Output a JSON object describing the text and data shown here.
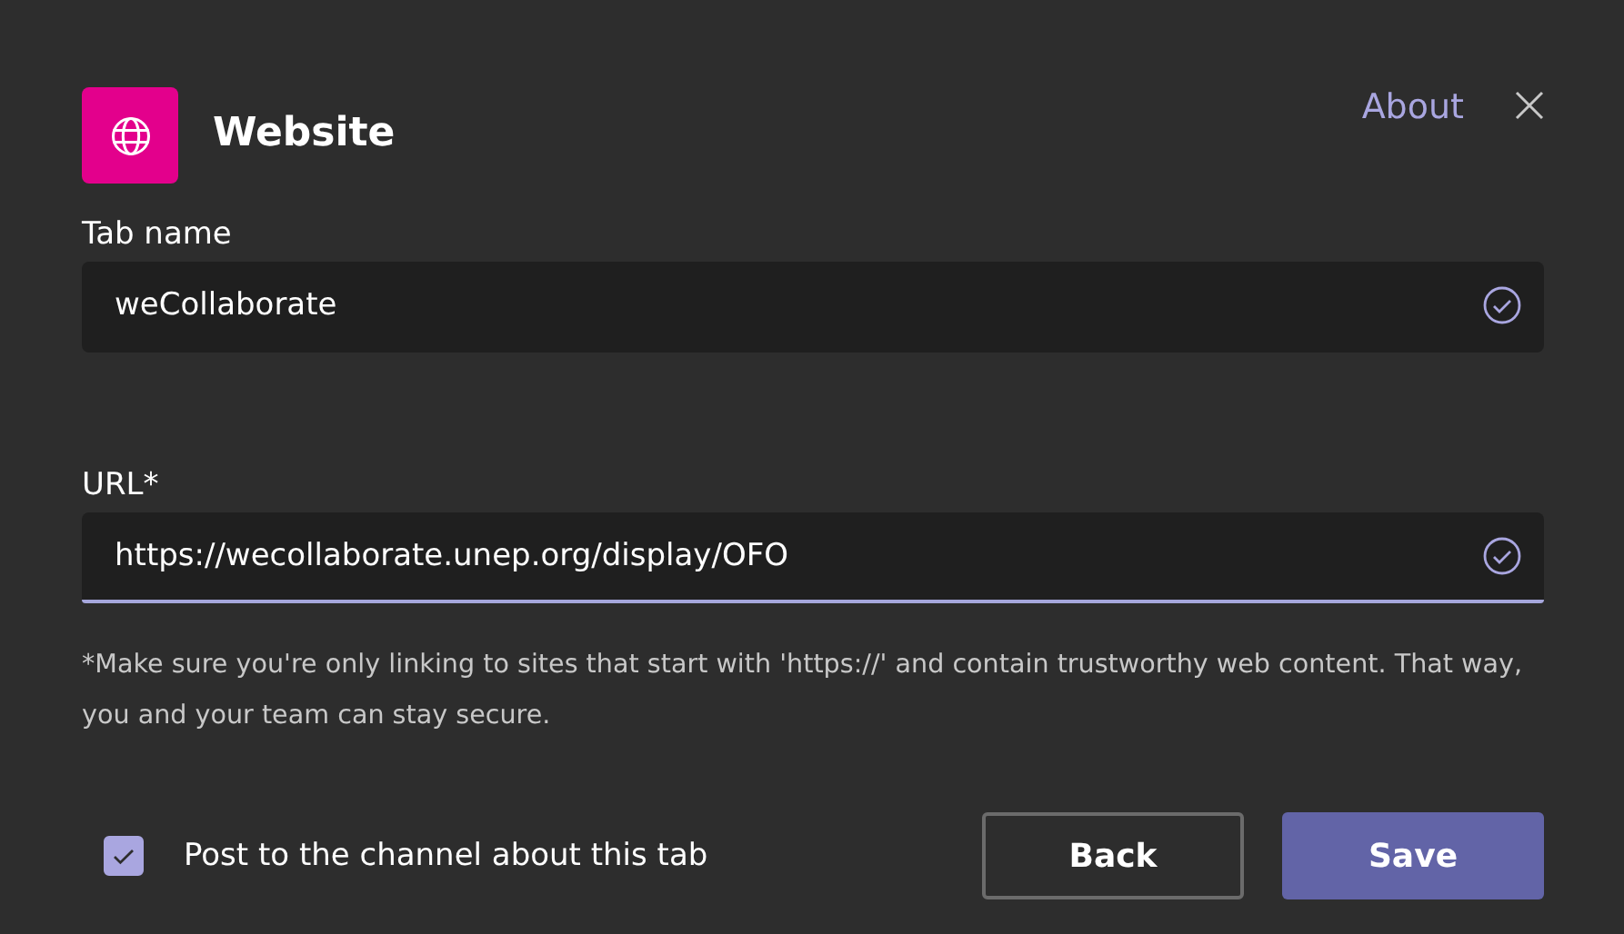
{
  "header": {
    "title": "Website",
    "about_link": "About"
  },
  "fields": [
    {
      "label": "Tab name",
      "value": "weCollaborate",
      "focused": false
    },
    {
      "label": "URL*",
      "value": "https://wecollaborate.unep.org/display/OFO",
      "focused": true
    }
  ],
  "help_text": "*Make sure you're only linking to sites that start with 'https://' and contain trustworthy web content. That way, you and your team can stay secure.",
  "post_option": {
    "label": "Post to the channel about this tab",
    "checked": true
  },
  "buttons": [
    {
      "label": "Back",
      "kind": "secondary"
    },
    {
      "label": "Save",
      "kind": "primary"
    }
  ]
}
